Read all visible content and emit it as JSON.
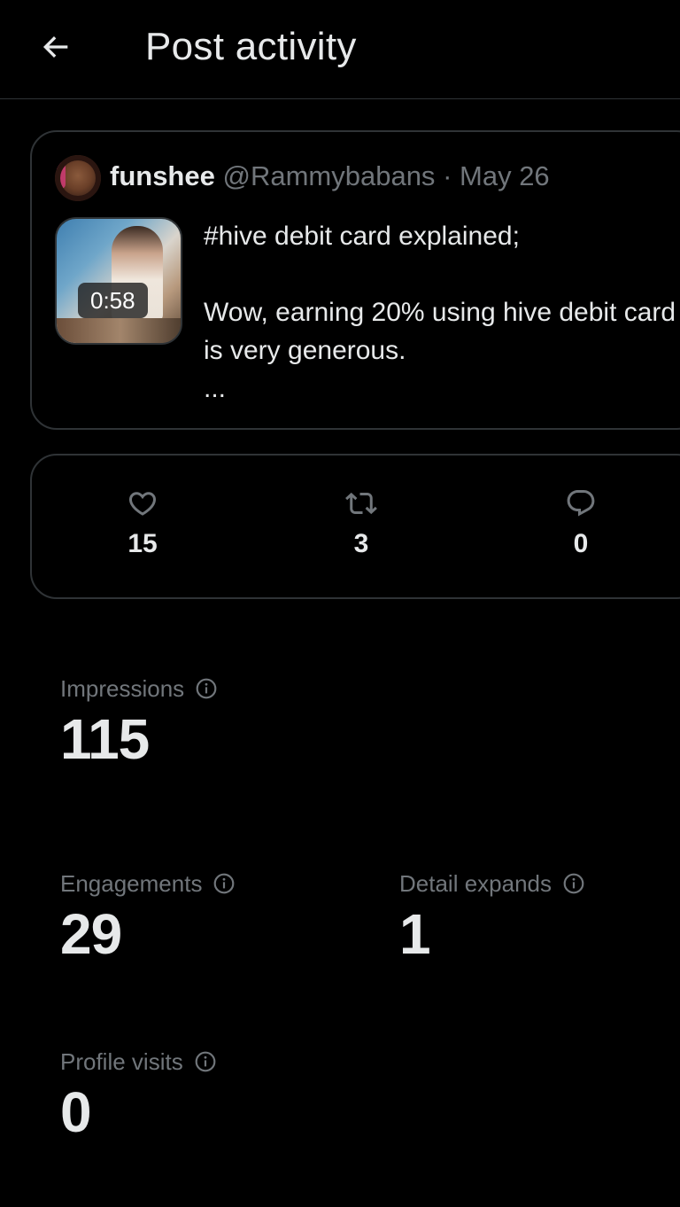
{
  "header": {
    "title": "Post activity"
  },
  "post": {
    "display_name": "funshee",
    "handle": "@Rammybabans",
    "separator": "·",
    "date": "May 26",
    "video_duration": "0:58",
    "text_line1": "#hive debit card explained;",
    "text_line2": "Wow, earning 20% using hive debit card is very generous.",
    "text_ellipsis": "..."
  },
  "engagement_bar": {
    "likes": "15",
    "reposts": "3",
    "replies": "0"
  },
  "metrics": {
    "impressions": {
      "label": "Impressions",
      "value": "115"
    },
    "engagements": {
      "label": "Engagements",
      "value": "29"
    },
    "detail_expands": {
      "label": "Detail expands",
      "value": "1"
    },
    "profile_visits": {
      "label": "Profile visits",
      "value": "0"
    }
  },
  "icons": {
    "back": "arrow-left-icon",
    "like": "heart-icon",
    "repost": "repost-icon",
    "reply": "reply-icon",
    "info": "info-icon"
  },
  "colors": {
    "background": "#000000",
    "text_primary": "#e7e9ea",
    "text_secondary": "#71767b",
    "border": "#2f3336"
  }
}
